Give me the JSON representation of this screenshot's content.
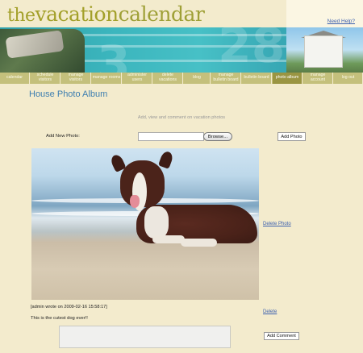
{
  "app": {
    "logo_prefix": "the",
    "logo_word1": "vacation",
    "logo_word2": "calendar",
    "help_link": "Need Help?"
  },
  "nav": {
    "items": [
      {
        "label": "calendar"
      },
      {
        "label": "schedule visitors"
      },
      {
        "label": "manage visitors"
      },
      {
        "label": "manage rooms"
      },
      {
        "label": "administer users"
      },
      {
        "label": "delete vacations"
      },
      {
        "label": "blog"
      },
      {
        "label": "manage bulletin board"
      },
      {
        "label": "bulletin board"
      },
      {
        "label": "photo album",
        "active": true
      },
      {
        "label": "manage account"
      },
      {
        "label": "log out"
      }
    ]
  },
  "page": {
    "title": "House Photo Album",
    "subtitle": "Add, view and comment on vacation photos"
  },
  "upload": {
    "label": "Add New Photo:",
    "file_value": "",
    "browse_label": "Browse...",
    "add_button": "Add Photo"
  },
  "photo": {
    "delete_label": "Delete Photo",
    "comment": {
      "meta": "[admin wrote on 2009-02-16 15:58:17]",
      "text": "This is the cutest dog ever!!",
      "delete_label": "Delete"
    }
  },
  "comment_form": {
    "value": "",
    "submit_label": "Add Comment"
  },
  "colors": {
    "background": "#f3ebcd",
    "nav": "#c4c07c",
    "nav_active": "#9a9542",
    "title": "#3d7eb0",
    "link": "#3b5fae"
  }
}
